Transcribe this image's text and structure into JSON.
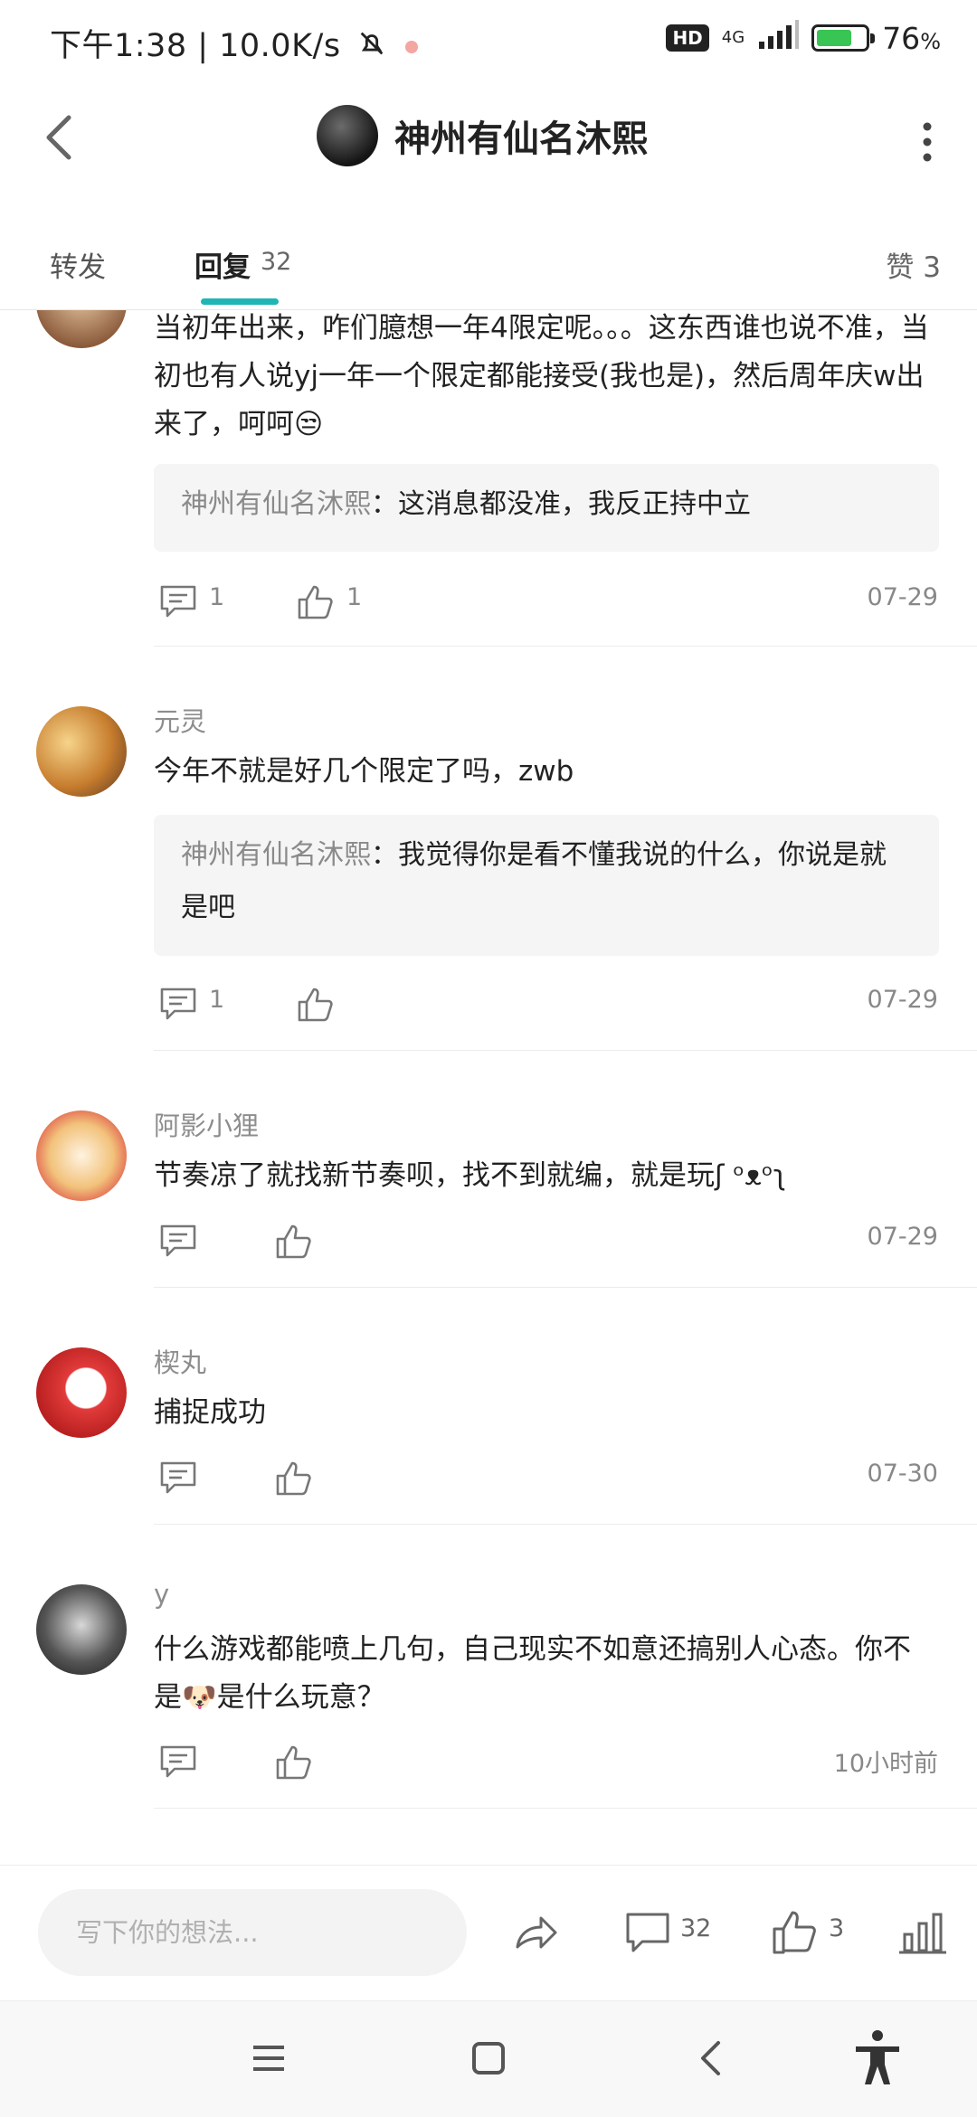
{
  "status_bar": {
    "time_speed": "下午1:38 | 10.0K/s",
    "hd": "HD",
    "network": "4G",
    "battery": "76",
    "battery_unit": "%",
    "battery_level": 0.76
  },
  "header": {
    "title": "神州有仙名沐熙"
  },
  "tabs": {
    "repost": "转发",
    "reply": "回复",
    "reply_count": "32",
    "like": "赞 3"
  },
  "comments": [
    {
      "text": "当初年出来，咋们臆想一年4限定呢。。。这东西谁也说不准，当初也有人说yj一年一个限定都能接受(我也是)，然后周年庆w出来了，呵呵😒",
      "reply_name": "神州有仙名沐熙",
      "reply_text": "：这消息都没准，我反正持中立",
      "reply_count": "1",
      "like_count": "1",
      "date": "07-29"
    },
    {
      "name": "元灵",
      "text": "今年不就是好几个限定了吗，zwb",
      "reply_name": "神州有仙名沐熙",
      "reply_text": "：我觉得你是看不懂我说的什么，你说是就是吧",
      "reply_count": "1",
      "date": "07-29"
    },
    {
      "name": "阿影小狸",
      "text": "节奏凉了就找新节奏呗，找不到就编，就是玩ʃ ᵒᴥᵒʅ",
      "date": "07-29"
    },
    {
      "name": "楔丸",
      "text": "捕捉成功",
      "date": "07-30"
    },
    {
      "name": "y",
      "text": "什么游戏都能喷上几句，自己现实不如意还搞别人心态。你不是🐶是什么玩意？",
      "date": "10小时前"
    }
  ],
  "bottom_bar": {
    "input_placeholder": "写下你的想法...",
    "comment_count": "32",
    "like_count": "3"
  },
  "icons": {
    "back": "chevron-left-icon",
    "more": "more-vertical-icon",
    "comment": "comment-icon",
    "like": "thumbs-up-icon",
    "share": "share-icon",
    "stats": "stats-icon"
  },
  "colors": {
    "accent": "#20b5b5",
    "text": "#222222",
    "muted": "#8d8d8d",
    "reply_bg": "#f5f5f6"
  }
}
